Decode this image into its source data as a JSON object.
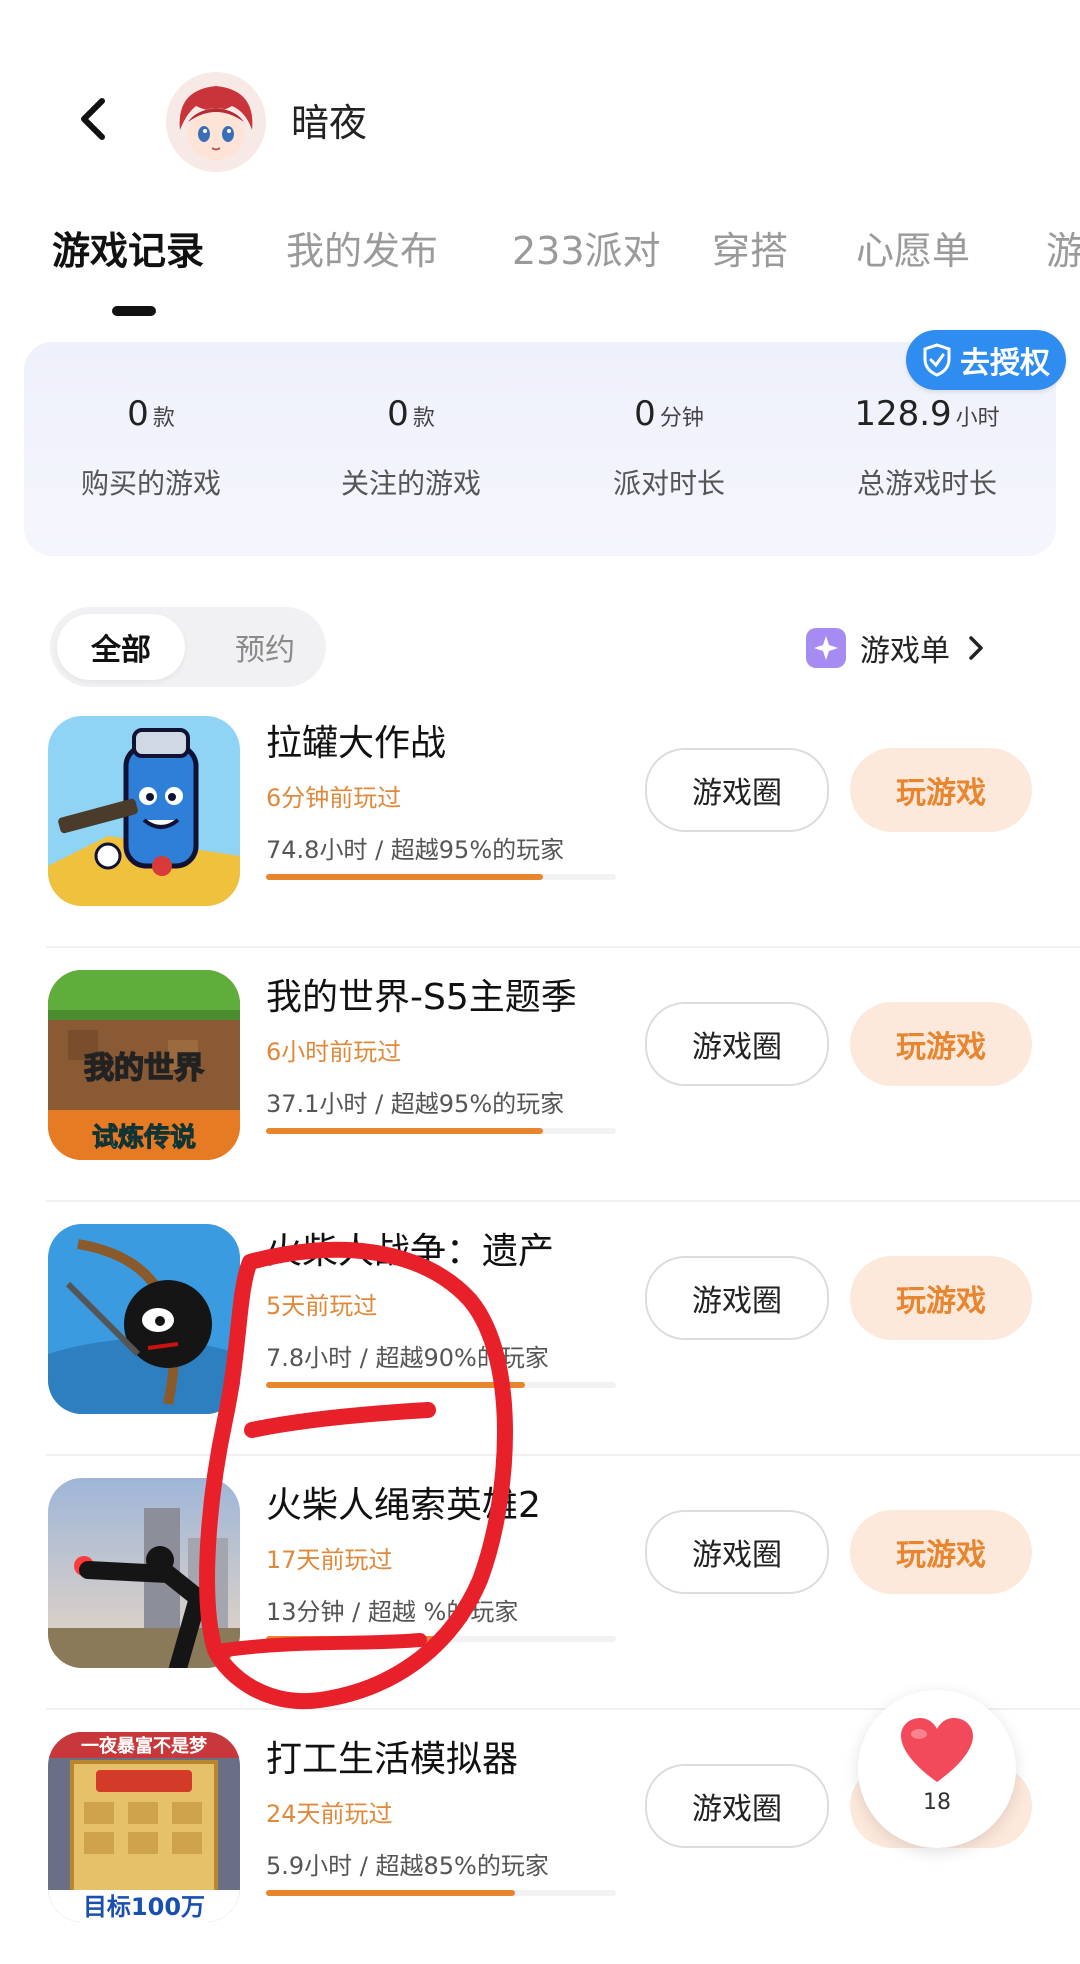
{
  "header": {
    "username": "暗夜"
  },
  "tabs": [
    "游戏记录",
    "我的发布",
    "233派对",
    "穿搭",
    "心愿单",
    "游"
  ],
  "stats": {
    "auth_label": "去授权",
    "items": [
      {
        "value": "0",
        "unit": "款",
        "label": "购买的游戏"
      },
      {
        "value": "0",
        "unit": "款",
        "label": "关注的游戏"
      },
      {
        "value": "0",
        "unit": "分钟",
        "label": "派对时长"
      },
      {
        "value": "128.9",
        "unit": "小时",
        "label": "总游戏时长"
      }
    ]
  },
  "filter": {
    "all": "全部",
    "reserve": "预约",
    "gamelist": "游戏单"
  },
  "games": [
    {
      "name": "拉罐大作战",
      "last_played": "6分钟前玩过",
      "stat": "74.8小时 / 超越95%的玩家",
      "progress": 0.79,
      "circle_btn": "游戏圈",
      "play_btn": "玩游戏"
    },
    {
      "name": "我的世界-S5主题季",
      "last_played": "6小时前玩过",
      "stat": "37.1小时 / 超越95%的玩家",
      "progress": 0.79,
      "circle_btn": "游戏圈",
      "play_btn": "玩游戏",
      "icon_text_top": "我的世界",
      "icon_text_bottom": "试炼传说"
    },
    {
      "name": "火柴人战争：遗产",
      "last_played": "5天前玩过",
      "stat": "7.8小时 / 超越90%的玩家",
      "progress": 0.74,
      "circle_btn": "游戏圈",
      "play_btn": "玩游戏"
    },
    {
      "name": "火柴人绳索英雄2",
      "last_played": "17天前玩过",
      "stat": "13分钟 / 超越 %的玩家",
      "progress": 0.5,
      "circle_btn": "游戏圈",
      "play_btn": "玩游戏"
    },
    {
      "name": "打工生活模拟器",
      "last_played": "24天前玩过",
      "stat": "5.9小时 / 超越85%的玩家",
      "progress": 0.71,
      "circle_btn": "游戏圈",
      "play_btn": "玩游戏",
      "icon_text_top": "一夜暴富不是梦",
      "icon_text_bottom": "目标100万"
    }
  ],
  "fab": {
    "likes": "18"
  },
  "colors": {
    "accent": "#e8852f",
    "auth_blue": "#2f8cf0",
    "annotation_red": "#e8202a"
  }
}
